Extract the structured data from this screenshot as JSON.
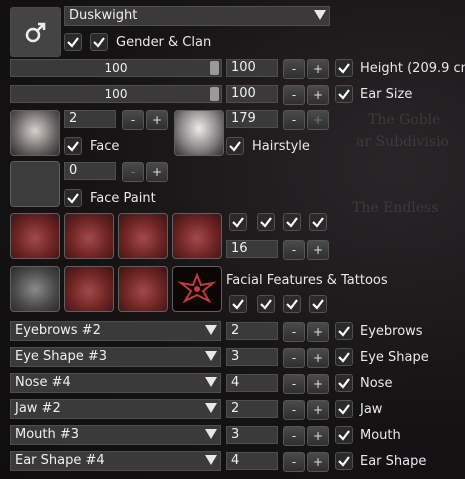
{
  "race": {
    "selected": "Duskwight",
    "gender_clan_label": "Gender & Clan"
  },
  "height": {
    "slider_value": "100",
    "value": "100",
    "label": "Height (209.9 cm"
  },
  "ear_size": {
    "slider_value": "100",
    "value": "100",
    "label": "Ear Size"
  },
  "face": {
    "value": "2",
    "label": "Face"
  },
  "hairstyle": {
    "value": "179",
    "label": "Hairstyle"
  },
  "face_paint": {
    "value": "0",
    "label": "Face Paint"
  },
  "facial_features": {
    "value": "16",
    "label": "Facial Features & Tattoos"
  },
  "features": [
    {
      "option": "Eyebrows #2",
      "value": "2",
      "label": "Eyebrows"
    },
    {
      "option": "Eye Shape #3",
      "value": "3",
      "label": "Eye Shape"
    },
    {
      "option": "Nose #4",
      "value": "4",
      "label": "Nose"
    },
    {
      "option": "Jaw #2",
      "value": "2",
      "label": "Jaw"
    },
    {
      "option": "Mouth #3",
      "value": "3",
      "label": "Mouth"
    },
    {
      "option": "Ear Shape #4",
      "value": "4",
      "label": "Ear Shape"
    }
  ],
  "controls": {
    "minus": "-",
    "plus": "+"
  },
  "background_text": {
    "line1": "The Goble",
    "line2": "ar Subdivisio",
    "line3": "The Endless"
  },
  "icons": {
    "gender": "male-symbol-icon",
    "dropdown": "triangle-down-icon",
    "check": "checkmark-icon"
  },
  "colors": {
    "panel": "#3a3a3a",
    "background": "#141214",
    "accent_red": "#8a2e2e"
  }
}
